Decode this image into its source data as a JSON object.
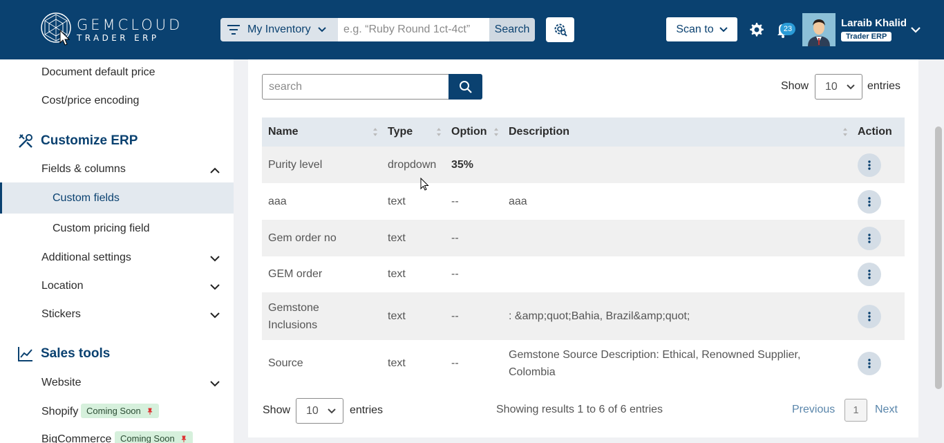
{
  "header": {
    "brand_name": "GEMCLOUD",
    "brand_sub": "TRADER ERP",
    "inventory_label": "My Inventory",
    "search_placeholder": "e.g. “Ruby Round 1ct-4ct”",
    "search_button": "Search",
    "scan_label": "Scan to",
    "notification_count": "23",
    "user_name": "Laraib Khalid",
    "user_role": "Trader ERP"
  },
  "sidebar": {
    "items_top": [
      {
        "label": "Document default price"
      },
      {
        "label": "Cost/price encoding"
      }
    ],
    "section_customize": "Customize ERP",
    "fields_columns": "Fields & columns",
    "custom_fields": "Custom fields",
    "custom_pricing": "Custom pricing field",
    "additional_settings": "Additional settings",
    "location": "Location",
    "stickers": "Stickers",
    "section_sales": "Sales tools",
    "website": "Website",
    "shopify": "Shopify",
    "bigcommerce": "BigCommerce",
    "coming_soon": "Coming Soon"
  },
  "table_controls": {
    "search_placeholder": "search",
    "show_label": "Show",
    "entries_label": "entries",
    "page_length": "10"
  },
  "table": {
    "columns": [
      "Name",
      "Type",
      "Option",
      "Description",
      "Action"
    ],
    "rows": [
      {
        "name": "Purity level",
        "type": "dropdown",
        "option": "35%",
        "description": ""
      },
      {
        "name": "aaa",
        "type": "text",
        "option": "--",
        "description": "aaa"
      },
      {
        "name": "Gem order no",
        "type": "text",
        "option": "--",
        "description": ""
      },
      {
        "name": "GEM order",
        "type": "text",
        "option": "--",
        "description": ""
      },
      {
        "name": "Gemstone Inclusions",
        "type": "text",
        "option": "--",
        "description": ": &amp;quot;Bahia, Brazil&amp;quot;"
      },
      {
        "name": "Source",
        "type": "text",
        "option": "--",
        "description": "Gemstone Source Description: Ethical, Renowned Supplier, Colombia"
      }
    ]
  },
  "pagination": {
    "showing": "Showing results 1 to 6 of 6 entries",
    "previous": "Previous",
    "current_page": "1",
    "next": "Next"
  },
  "colors": {
    "brand": "#0a4170",
    "header_row": "#e3e9ef",
    "coming_soon_bg": "#d6f0dc"
  }
}
